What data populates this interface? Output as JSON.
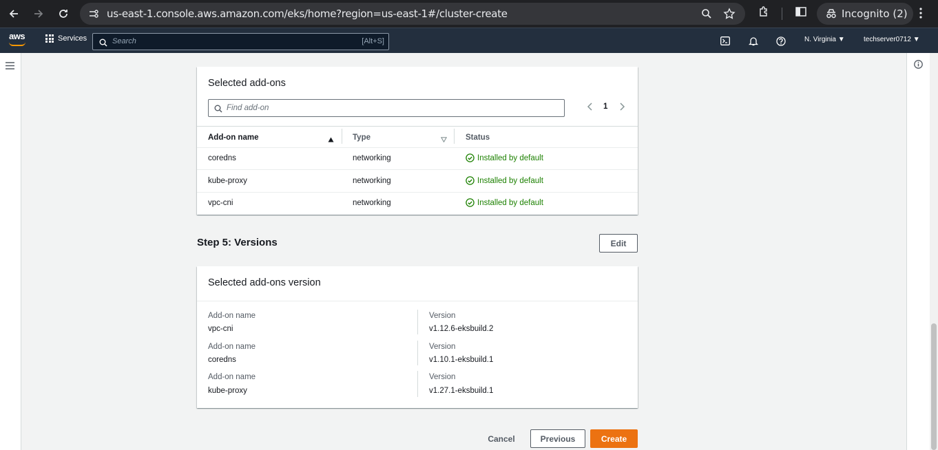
{
  "browser": {
    "url": "us-east-1.console.aws.amazon.com/eks/home?region=us-east-1#/cluster-create",
    "incognito_label": "Incognito (2)"
  },
  "aws_nav": {
    "logo": "aws",
    "services_label": "Services",
    "search_placeholder": "Search",
    "search_shortcut": "[Alt+S]",
    "region": "N. Virginia",
    "account": "techserver0712"
  },
  "addons_panel": {
    "title": "Selected add-ons",
    "find_placeholder": "Find add-on",
    "page_number": "1",
    "columns": [
      "Add-on name",
      "Type",
      "Status"
    ],
    "rows": [
      {
        "name": "coredns",
        "type": "networking",
        "status": "Installed by default"
      },
      {
        "name": "kube-proxy",
        "type": "networking",
        "status": "Installed by default"
      },
      {
        "name": "vpc-cni",
        "type": "networking",
        "status": "Installed by default"
      }
    ]
  },
  "step5": {
    "title": "Step 5: Versions",
    "edit_label": "Edit"
  },
  "versions_panel": {
    "title": "Selected add-ons version",
    "name_label": "Add-on name",
    "version_label": "Version",
    "rows": [
      {
        "name": "vpc-cni",
        "version": "v1.12.6-eksbuild.2"
      },
      {
        "name": "coredns",
        "version": "v1.10.1-eksbuild.1"
      },
      {
        "name": "kube-proxy",
        "version": "v1.27.1-eksbuild.1"
      }
    ]
  },
  "actions": {
    "cancel": "Cancel",
    "previous": "Previous",
    "create": "Create"
  },
  "colors": {
    "primary": "#ec7211",
    "success": "#1d8102",
    "nav_bg": "#232f3e"
  }
}
